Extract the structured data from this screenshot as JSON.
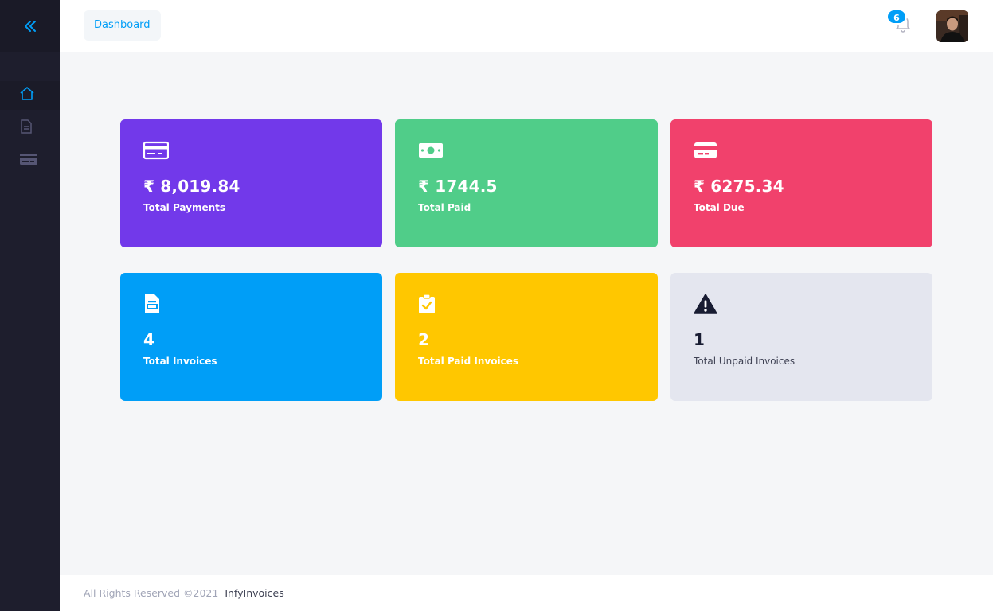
{
  "header": {
    "breadcrumb": "Dashboard",
    "notification_count": "6"
  },
  "sidebar": {
    "toggle_icon": "double-chevron-left-icon",
    "items": [
      {
        "icon": "home-icon",
        "active": true
      },
      {
        "icon": "document-icon",
        "active": false
      },
      {
        "icon": "credit-card-icon",
        "active": false
      }
    ]
  },
  "stats": [
    {
      "value": "₹ 8,019.84",
      "label": "Total Payments",
      "icon": "credit-card-icon",
      "color": "#7239ea"
    },
    {
      "value": "₹  1744.5",
      "label": "Total Paid",
      "icon": "money-bill-icon",
      "color": "#50cd89"
    },
    {
      "value": "₹  6275.34",
      "label": "Total Due",
      "icon": "card-icon",
      "color": "#f1416c"
    },
    {
      "value": "4",
      "label": "Total Invoices",
      "icon": "invoice-icon",
      "color": "#009ef7"
    },
    {
      "value": "2",
      "label": "Total Paid Invoices",
      "icon": "clipboard-check-icon",
      "color": "#ffc700"
    },
    {
      "value": "1",
      "label": "Total Unpaid Invoices",
      "icon": "warning-icon",
      "color": "#e4e6ef"
    }
  ],
  "footer": {
    "copyright": "All Rights Reserved ©2021",
    "brand": "InfyInvoices"
  }
}
